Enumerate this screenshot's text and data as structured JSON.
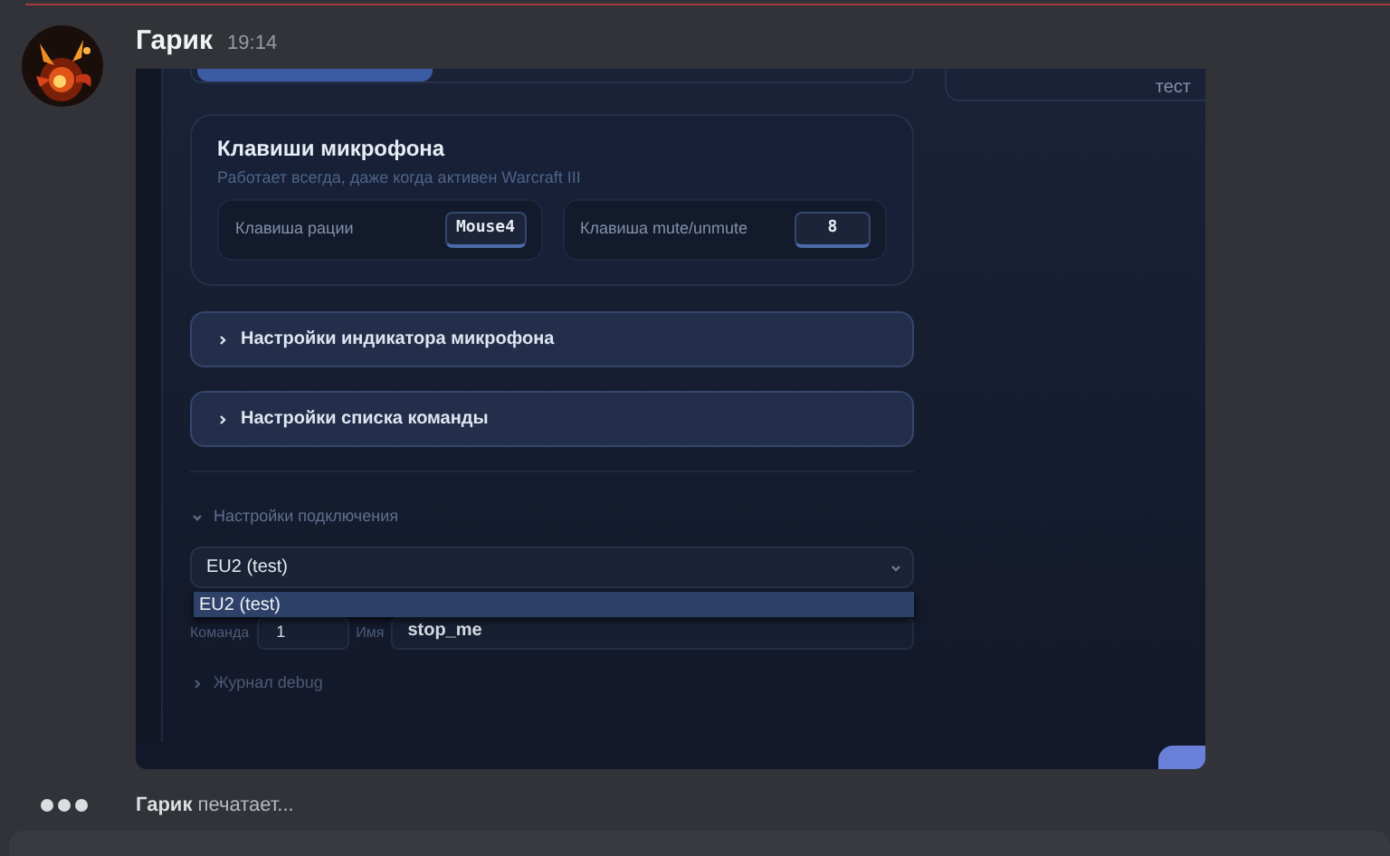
{
  "message": {
    "author": "Гарик",
    "time": "19:14"
  },
  "screenshot": {
    "top_card_text": "тест",
    "mic_keys": {
      "title": "Клавиши микрофона",
      "subtitle": "Работает всегда, даже когда активен Warcraft III",
      "keys": [
        {
          "label": "Клавиша рации",
          "value": "Mouse4"
        },
        {
          "label": "Клавиша mute/unmute",
          "value": "8"
        }
      ]
    },
    "sections": [
      {
        "label": "Настройки индикатора микрофона",
        "expanded": false
      },
      {
        "label": "Настройки списка команды",
        "expanded": false
      }
    ],
    "connection": {
      "label": "Настройки подключения",
      "expanded": true,
      "server_select": {
        "value": "EU2 (test)",
        "options": [
          {
            "label": "EU2 (test)",
            "selected": true
          }
        ]
      },
      "team_label": "Команда",
      "team_value": "1",
      "name_label": "Имя",
      "name_value": "stop_me"
    },
    "debug": {
      "label": "Журнал debug",
      "expanded": false
    }
  },
  "typing": {
    "user": "Гарик",
    "text": "печатает..."
  }
}
